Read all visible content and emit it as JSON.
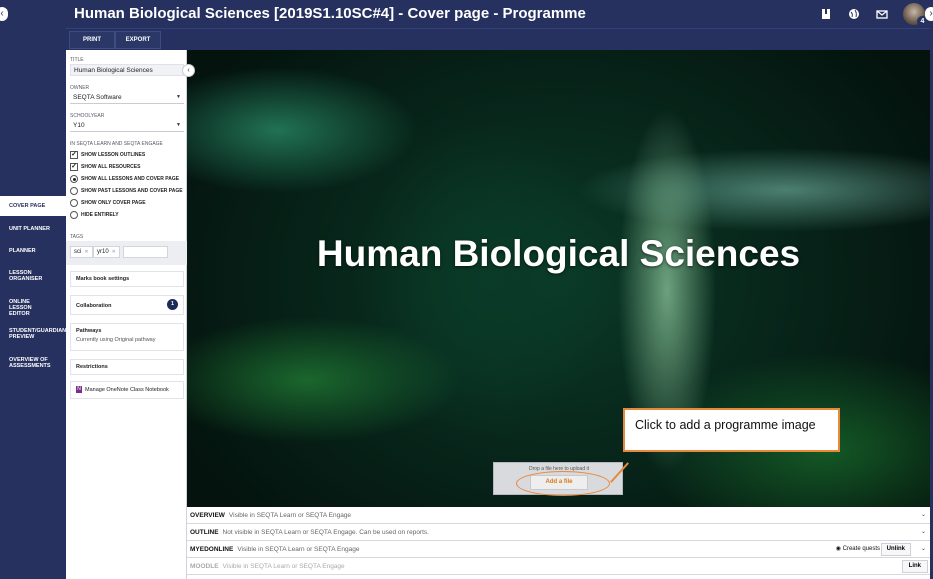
{
  "header": {
    "title": "Human Biological Sciences [2019S1.10SC#4] - Cover page - Programme",
    "avatar_badge": "4",
    "icons": [
      "book-icon",
      "globe-icon",
      "mail-icon"
    ]
  },
  "toolbar": {
    "print_label": "PRINT",
    "export_label": "EXPORT"
  },
  "nav": {
    "items": [
      {
        "label": "COVER PAGE",
        "active": true
      },
      {
        "label": "UNIT PLANNER"
      },
      {
        "label": "PLANNER"
      },
      {
        "label": "LESSON ORGANISER"
      },
      {
        "label": "ONLINE LESSON EDITOR"
      },
      {
        "label": "STUDENT/GUARDIAN PREVIEW"
      },
      {
        "label": "OVERVIEW OF ASSESSMENTS"
      }
    ]
  },
  "settings": {
    "title_label": "TITLE",
    "title_value": "Human Biological Sciences",
    "owner_label": "OWNER",
    "owner_value": "SEQTA Software",
    "schoolyear_label": "SCHOOLYEAR",
    "schoolyear_value": "Y10",
    "engage_label": "IN SEQTA LEARN AND SEQTA ENGAGE",
    "options": [
      {
        "label": "SHOW LESSON OUTLINES",
        "type": "checkbox",
        "checked": true
      },
      {
        "label": "SHOW ALL RESOURCES",
        "type": "checkbox",
        "checked": true
      },
      {
        "label": "SHOW ALL LESSONS AND COVER PAGE",
        "type": "radio",
        "checked": true
      },
      {
        "label": "SHOW PAST LESSONS AND COVER PAGE",
        "type": "radio",
        "checked": false
      },
      {
        "label": "SHOW ONLY COVER PAGE",
        "type": "radio",
        "checked": false
      },
      {
        "label": "HIDE ENTIRELY",
        "type": "radio",
        "checked": false
      }
    ],
    "tags_label": "TAGS",
    "tags": [
      "sci",
      "yr10"
    ],
    "marks_book": "Marks book settings",
    "collaboration": "Collaboration",
    "collaboration_count": "1",
    "pathways": "Pathways",
    "pathways_sub": "Currently using Original pathway",
    "restrictions": "Restrictions",
    "onenote": "Manage OneNote Class Notebook"
  },
  "hero": {
    "title": "Human Biological Sciences",
    "drop_hint": "Drop a file here to upload it",
    "add_file": "Add a file",
    "callout": "Click to add a programme image"
  },
  "sections": [
    {
      "name": "OVERVIEW",
      "desc": "Visible in SEQTA Learn or SEQTA Engage"
    },
    {
      "name": "OUTLINE",
      "desc": "Not visible in SEQTA Learn or SEQTA Engage. Can be used on reports."
    },
    {
      "name": "MYEDONLINE",
      "desc": "Visible in SEQTA Learn or SEQTA Engage",
      "quests": "Create quests",
      "unlink": "Unlink"
    },
    {
      "name": "MOODLE",
      "desc": "Visible in SEQTA Learn or SEQTA Engage",
      "link": "Link"
    }
  ],
  "colors": {
    "navy": "#26315f",
    "accent_orange": "#e8883a"
  }
}
